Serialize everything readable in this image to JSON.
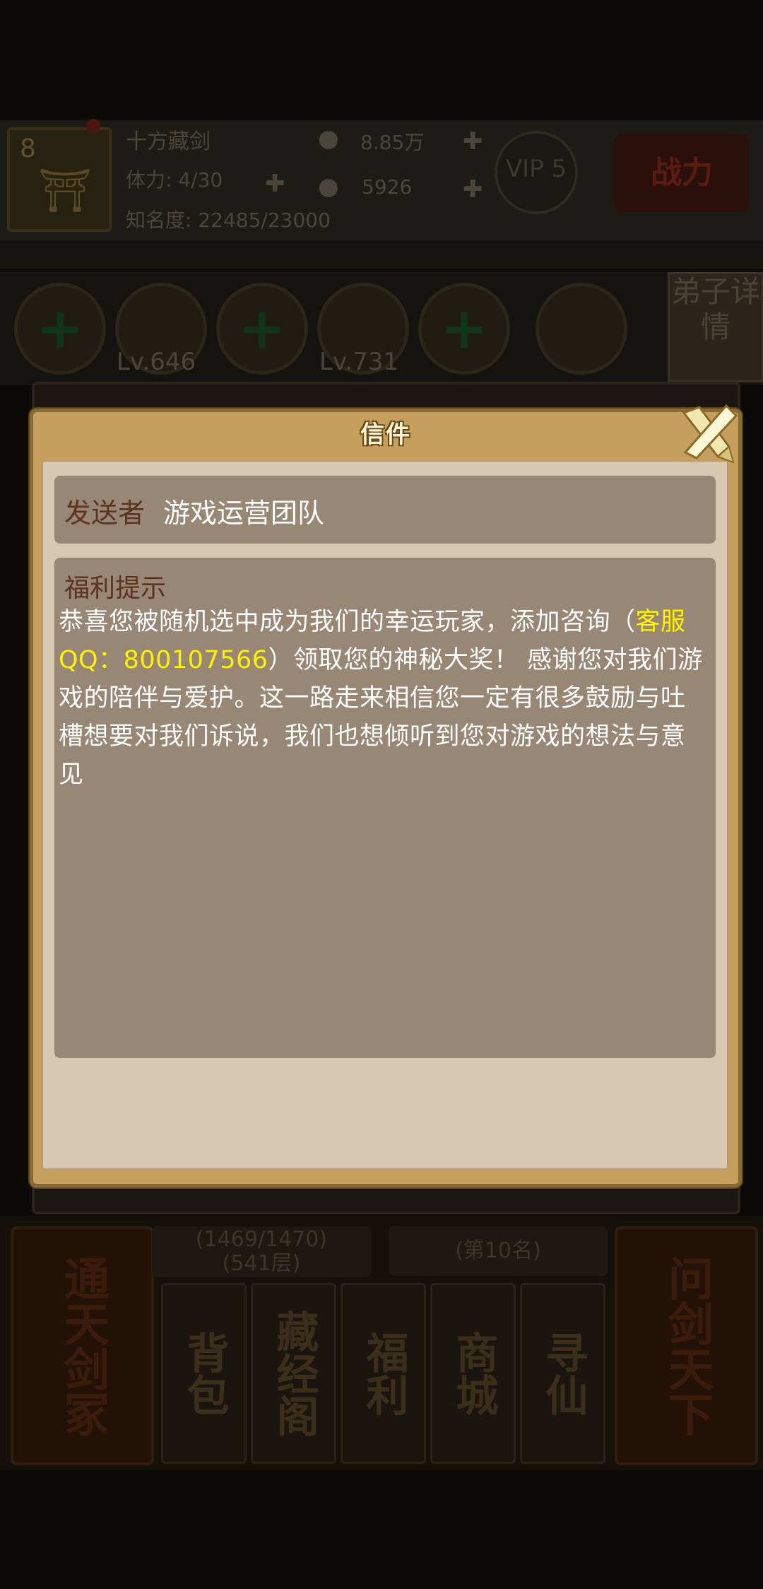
{
  "background": {
    "player_name": "十方藏剑",
    "avatar_level": "8",
    "stamina": "体力: 4/30",
    "fame": "知名度: 22485/23000",
    "silver": "8.85万",
    "gold": "5926",
    "vip": "VIP 5",
    "combat_power_label": "战力",
    "disciple_detail": "弟子详情",
    "roster_levels": [
      "Lv.646",
      "Lv.731"
    ],
    "tower_progress": "(1469/1470)",
    "tower_floor": "(541层)",
    "rank": "(第10名)",
    "big_buttons": [
      "通天剑冢",
      "问剑天下"
    ],
    "small_buttons": [
      "背包",
      "藏经阁",
      "福利",
      "商城",
      "寻仙"
    ]
  },
  "modal": {
    "title": "信件",
    "sender_label": "发送者",
    "sender_value": "游戏运营团队",
    "subject": "福利提示",
    "body_part1": "恭喜您被随机选中成为我们的幸运玩家，添加咨询（",
    "body_highlight": "客服QQ：800107566",
    "body_part2": "）领取您的神秘大奖！ 感谢您对我们游戏的陪伴与爱护。这一路走来相信您一定有很多鼓励与吐槽想要对我们诉说，我们也想倾听到您对游戏的想法与意见",
    "accent_color": "#fff200"
  }
}
